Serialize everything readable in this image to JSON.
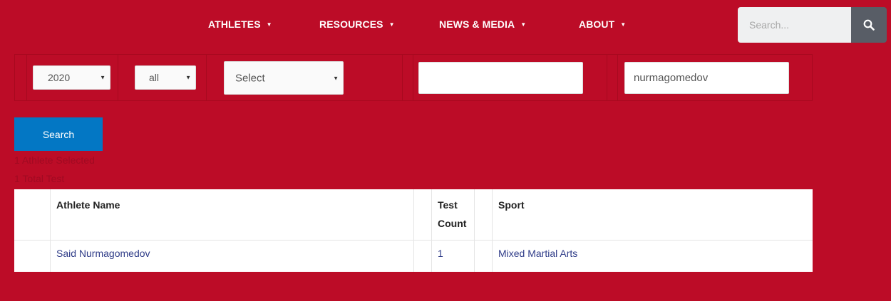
{
  "nav": {
    "items": [
      {
        "label": "ATHLETES",
        "caret": "▼"
      },
      {
        "label": "RESOURCES",
        "caret": "▼"
      },
      {
        "label": "NEWS & MEDIA",
        "caret": "▼"
      },
      {
        "label": "ABOUT",
        "caret": "▼"
      }
    ],
    "search_placeholder": "Search...",
    "search_icon": "search-icon"
  },
  "filters": {
    "year": {
      "value": "2020",
      "arrow": "▼"
    },
    "scope": {
      "value": "all",
      "arrow": "▼"
    },
    "sport": {
      "value": "Select",
      "arrow": "▼"
    },
    "text_a": {
      "value": ""
    },
    "name": {
      "value": "nurmagomedov"
    }
  },
  "search_button_label": "Search",
  "summary": {
    "selected": "1 Athlete Selected",
    "total": "1 Total Test"
  },
  "results": {
    "columns": [
      "Athlete Name",
      "Test",
      "Count",
      "Sport"
    ],
    "rows": [
      {
        "athlete": "Said Nurmagomedov",
        "count": "1",
        "sport": "Mixed Martial Arts"
      }
    ]
  },
  "colors": {
    "background": "#bc0c27",
    "button": "#0377c4",
    "link": "#2f3c88"
  }
}
